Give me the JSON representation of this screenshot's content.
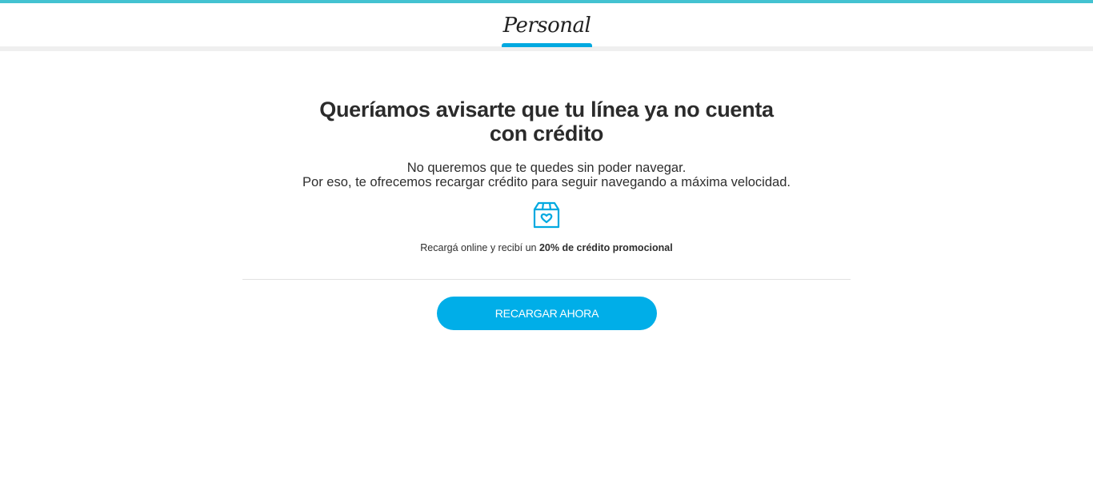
{
  "header": {
    "logo_text": "Personal",
    "accent_color": "#43c2d1",
    "brand_color": "#00a9e0"
  },
  "main": {
    "headline": "Queríamos avisarte que tu línea ya no cuenta con crédito",
    "subtitle_line1": "No queremos que te quedes sin poder navegar.",
    "subtitle_line2": "Por eso, te ofrecemos recargar crédito para seguir navegando a máxima velocidad.",
    "icon": "gift-box-heart-icon",
    "promo_prefix": "Recargá online y recibí un ",
    "promo_bold": "20% de crédito promocional",
    "cta_label": "RECARGAR AHORA"
  }
}
